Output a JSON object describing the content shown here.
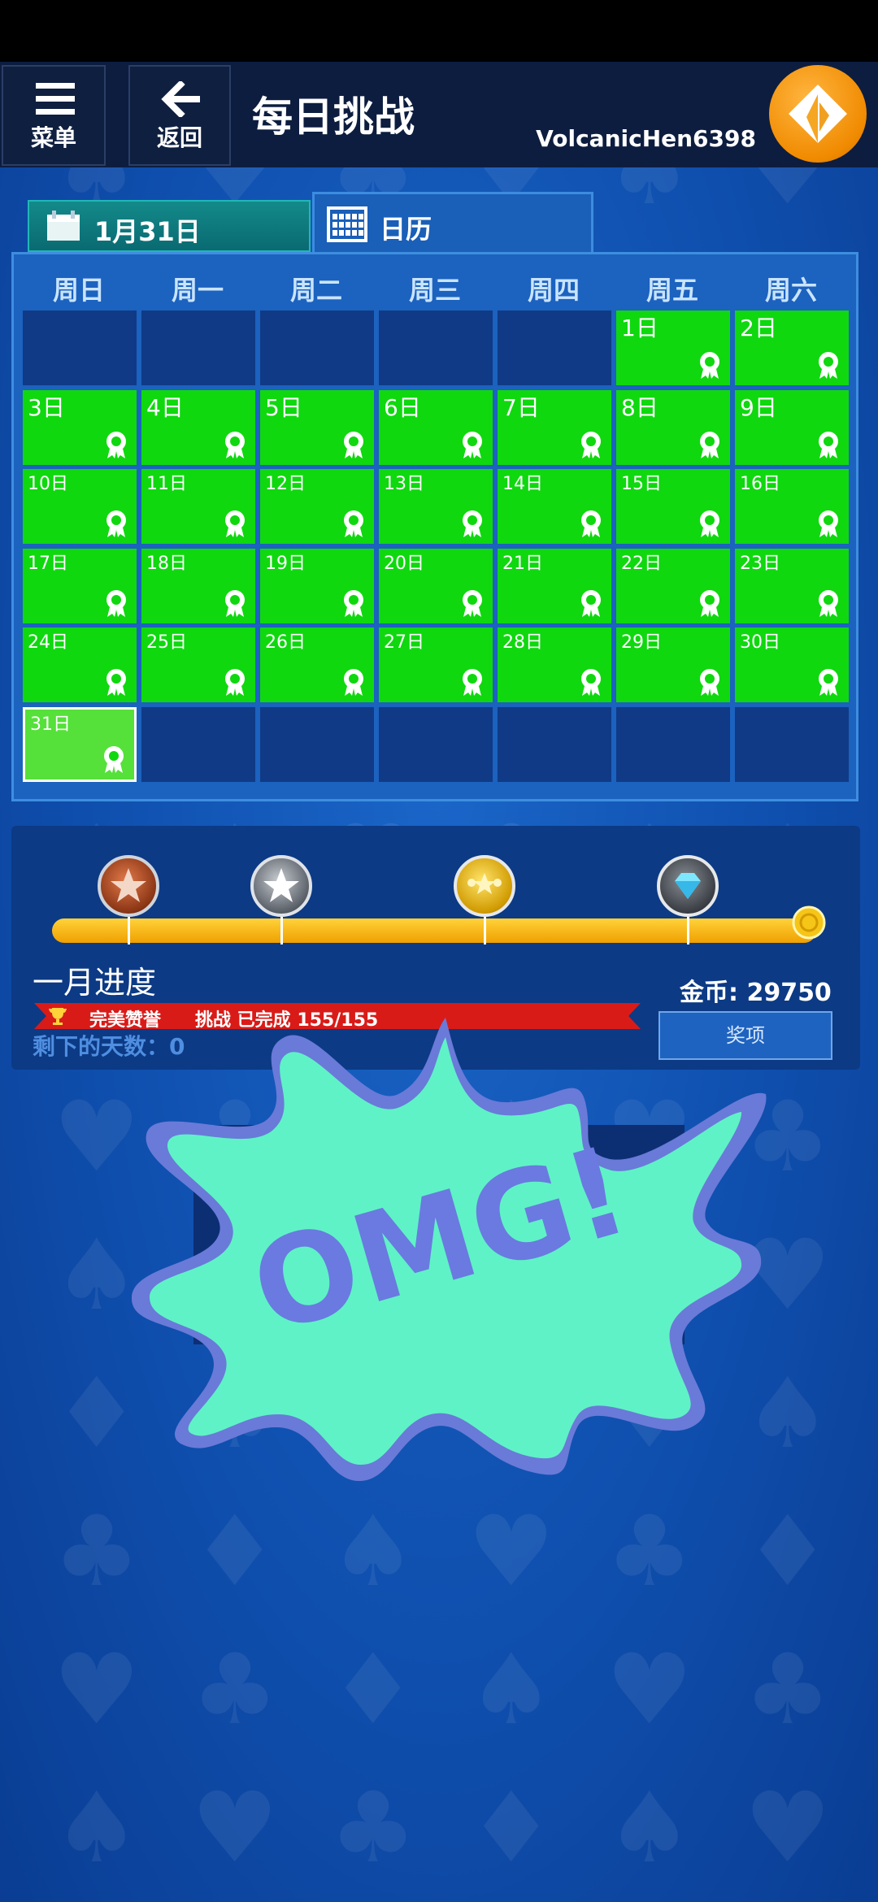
{
  "header": {
    "menu_label": "菜单",
    "back_label": "返回",
    "title": "每日挑战",
    "username": "VolcanicHen6398"
  },
  "tabs": {
    "date_label": "1月31日",
    "calendar_label": "日历"
  },
  "calendar": {
    "weekdays": [
      "周日",
      "周一",
      "周二",
      "周三",
      "周四",
      "周五",
      "周六"
    ],
    "first_weekday_index": 5,
    "days_in_month": 31,
    "today": 31,
    "day_labels": [
      "1日",
      "2日",
      "3日",
      "4日",
      "5日",
      "6日",
      "7日",
      "8日",
      "9日",
      "10日",
      "11日",
      "12日",
      "13日",
      "14日",
      "15日",
      "16日",
      "17日",
      "18日",
      "19日",
      "20日",
      "21日",
      "22日",
      "23日",
      "24日",
      "25日",
      "26日",
      "27日",
      "28日",
      "29日",
      "30日",
      "31日"
    ],
    "completed_color": "#0fd80f",
    "today_color": "#55e03a",
    "empty_color": "#103a86"
  },
  "progress": {
    "month_label": "一月进度",
    "coins_text": "金币: 29750",
    "ribbon_title": "完美赞誉",
    "ribbon_status": "挑战 已完成 155/155",
    "remaining_text": "剩下的天数：0",
    "rewards_button": "奖项",
    "completed": 155,
    "total": 155,
    "badges": [
      "bronze-star-badge",
      "silver-star-badge",
      "gold-star-badge",
      "diamond-badge"
    ]
  },
  "overlay": {
    "sticker_text": "OMG!",
    "sticker_color": "#5ff2c6",
    "sticker_text_color": "#6a7ae0"
  }
}
